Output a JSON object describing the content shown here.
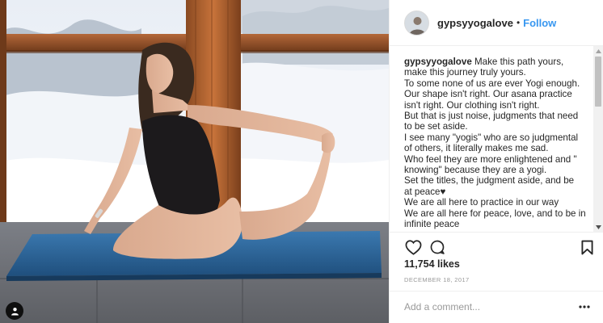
{
  "post": {
    "username": "gypsyyogalove",
    "separator": "•",
    "follow_label": "Follow",
    "caption": {
      "author": "gypsyyogalove",
      "first_line_text": "Make this path yours,",
      "lines": [
        "make this journey truly yours.",
        "To some none of us are ever Yogi enough.",
        "Our shape isn't right. Our asana practice",
        "isn't right. Our clothing isn't right.",
        "But that is just noise, judgments that need",
        "to be set aside.",
        "I see many \"yogis\" who are so judgmental",
        "of others, it literally makes me sad.",
        "Who feel they are more enlightened and \"",
        "knowing\" because they are a yogi.",
        "Set the titles, the judgment aside, and be",
        "at peace♥",
        "We are all here to practice in our way",
        "We are all here for peace, love, and to be in",
        "infinite peace"
      ]
    },
    "likes": "11,754 likes",
    "date": "December 18, 2017",
    "comment_placeholder": "Add a comment...",
    "icons": {
      "like": "heart-icon",
      "comment": "comment-bubble-icon",
      "save": "bookmark-icon",
      "more": "more-options-icon",
      "tag": "user-tag-icon"
    }
  }
}
